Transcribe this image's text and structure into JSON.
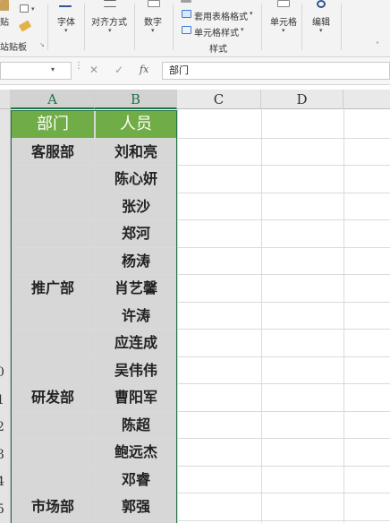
{
  "ribbon": {
    "paste_label": "贴",
    "clipboard_group_label": "站贴板",
    "font_label": "字体",
    "alignment_label": "对齐方式",
    "number_label": "数字",
    "table_format_label": "套用表格格式",
    "cell_style_label": "单元格样式",
    "styles_group_label": "样式",
    "cells_label": "单元格",
    "editing_label": "编辑"
  },
  "formula_bar": {
    "cancel_symbol": "✕",
    "enter_symbol": "✓",
    "fx_symbol": "fx",
    "value": "部门"
  },
  "columns": [
    "A",
    "B",
    "C",
    "D"
  ],
  "row_numbers": [
    "0",
    "1",
    "2",
    "3",
    "4",
    "5"
  ],
  "header": {
    "col_a": "部门",
    "col_b": "人员"
  },
  "rows": [
    {
      "dept": "客服部",
      "person": "刘和亮"
    },
    {
      "dept": "",
      "person": "陈心妍"
    },
    {
      "dept": "",
      "person": "张沙"
    },
    {
      "dept": "",
      "person": "郑河"
    },
    {
      "dept": "",
      "person": "杨涛"
    },
    {
      "dept": "推广部",
      "person": "肖艺馨"
    },
    {
      "dept": "",
      "person": "许涛"
    },
    {
      "dept": "",
      "person": "应连成"
    },
    {
      "dept": "",
      "person": "吴伟伟"
    },
    {
      "dept": "研发部",
      "person": "曹阳军"
    },
    {
      "dept": "",
      "person": "陈超"
    },
    {
      "dept": "",
      "person": "鲍远杰"
    },
    {
      "dept": "",
      "person": "邓睿"
    },
    {
      "dept": "市场部",
      "person": "郭强"
    }
  ],
  "colors": {
    "header_fill": "#70ad47",
    "selection_fill": "#d7d7d7",
    "selection_border": "#217346"
  }
}
